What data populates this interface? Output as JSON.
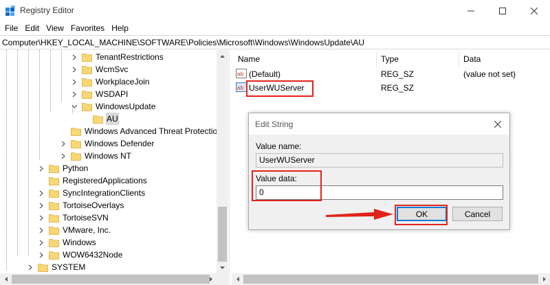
{
  "window": {
    "title": "Registry Editor",
    "minimize_glyph": "—",
    "close_glyph": "✕"
  },
  "menu": [
    "File",
    "Edit",
    "View",
    "Favorites",
    "Help"
  ],
  "address": "Computer\\HKEY_LOCAL_MACHINE\\SOFTWARE\\Policies\\Microsoft\\Windows\\WindowsUpdate\\AU",
  "tree": [
    {
      "label": "TenantRestrictions",
      "expander": "collapsed",
      "depth": 4
    },
    {
      "label": "WcmSvc",
      "expander": "collapsed",
      "depth": 4
    },
    {
      "label": "WorkplaceJoin",
      "expander": "collapsed",
      "depth": 4
    },
    {
      "label": "WSDAPI",
      "expander": "collapsed",
      "depth": 4
    },
    {
      "label": "WindowsUpdate",
      "expander": "expanded",
      "depth": 4
    },
    {
      "label": "AU",
      "expander": "none",
      "depth": 5,
      "selected": true
    },
    {
      "label": "Windows Advanced Threat Protection",
      "expander": "none",
      "depth": 3
    },
    {
      "label": "Windows Defender",
      "expander": "collapsed",
      "depth": 3
    },
    {
      "label": "Windows NT",
      "expander": "collapsed",
      "depth": 3
    },
    {
      "label": "Python",
      "expander": "collapsed",
      "depth": 1
    },
    {
      "label": "RegisteredApplications",
      "expander": "none",
      "depth": 1
    },
    {
      "label": "SyncIntegrationClients",
      "expander": "collapsed",
      "depth": 1
    },
    {
      "label": "TortoiseOverlays",
      "expander": "collapsed",
      "depth": 1
    },
    {
      "label": "TortoiseSVN",
      "expander": "collapsed",
      "depth": 1
    },
    {
      "label": "VMware, Inc.",
      "expander": "collapsed",
      "depth": 1
    },
    {
      "label": "Windows",
      "expander": "collapsed",
      "depth": 1
    },
    {
      "label": "WOW6432Node",
      "expander": "collapsed",
      "depth": 1
    },
    {
      "label": "SYSTEM",
      "expander": "collapsed",
      "depth": 0
    }
  ],
  "list": {
    "columns": [
      "Name",
      "Type",
      "Data"
    ],
    "rows": [
      {
        "name": "(Default)",
        "type": "REG_SZ",
        "data": "(value not set)",
        "icon": "string-value-icon"
      },
      {
        "name": "UserWUServer",
        "type": "REG_SZ",
        "data": "",
        "icon": "string-value-icon"
      }
    ]
  },
  "dialog": {
    "title": "Edit String",
    "value_name_label": "Value name:",
    "value_name": "UserWUServer",
    "value_data_label": "Value data:",
    "value_data": "0",
    "ok_label": "OK",
    "cancel_label": "Cancel"
  },
  "colors": {
    "annotation_red": "#e2231a",
    "folder_yellow": "#f8d775",
    "selection_gray": "#d9d9d9",
    "accent_blue": "#0078d7"
  }
}
